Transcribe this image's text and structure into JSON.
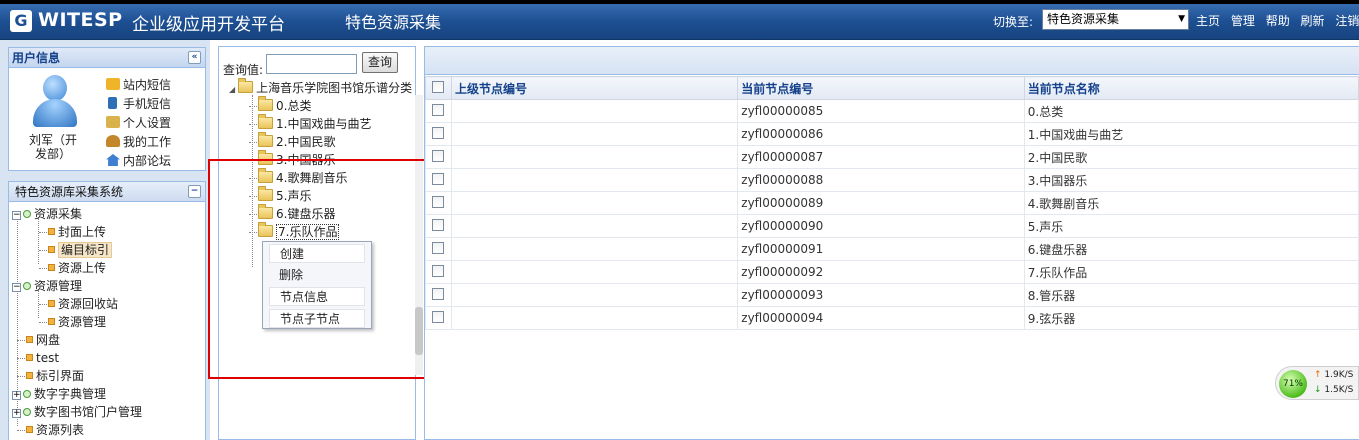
{
  "header": {
    "logo_mark": "G",
    "logo_text": "WITESP",
    "logo_sub": "企业级应用开发平台",
    "page_title": "特色资源采集",
    "switch_label": "切换至:",
    "switch_value": "特色资源采集",
    "links": [
      "主页",
      "管理",
      "帮助",
      "刷新",
      "注销"
    ]
  },
  "user_panel": {
    "title": "用户信息",
    "collapse_glyph": "«",
    "user_name": "刘军（开发部）",
    "links": [
      {
        "label": "站内短信",
        "icon": "mail-icon",
        "color": "#f0b429"
      },
      {
        "label": "手机短信",
        "icon": "phone-icon",
        "color": "#2f6fb8"
      },
      {
        "label": "个人设置",
        "icon": "pencil-icon",
        "color": "#d9b24c"
      },
      {
        "label": "我的工作",
        "icon": "worker-icon",
        "color": "#c4862b"
      },
      {
        "label": "内部论坛",
        "icon": "home-icon",
        "color": "#3e7fcf"
      }
    ]
  },
  "nav_panel": {
    "title": "特色资源库采集系统",
    "collapse_glyph": "−",
    "items": [
      {
        "label": "资源采集"
      },
      {
        "label": "封面上传"
      },
      {
        "label": "编目标引"
      },
      {
        "label": "资源上传"
      },
      {
        "label": "资源管理"
      },
      {
        "label": "资源回收站"
      },
      {
        "label": "资源管理"
      },
      {
        "label": "网盘"
      },
      {
        "label": "test"
      },
      {
        "label": "标引界面"
      },
      {
        "label": "数字字典管理"
      },
      {
        "label": "数字图书馆门户管理"
      },
      {
        "label": "资源列表"
      }
    ]
  },
  "tree": {
    "query_label": "查询值:",
    "query_value": "",
    "query_button": "查询",
    "root": "上海音乐学院图书馆乐谱分类",
    "nodes": [
      "0.总类",
      "1.中国戏曲与曲艺",
      "2.中国民歌",
      "3.中国器乐",
      "4.歌舞剧音乐",
      "5.声乐",
      "6.键盘乐器",
      "7.乐队作品"
    ]
  },
  "context_menu": {
    "items": [
      "创建",
      "删除",
      "节点信息",
      "节点子节点"
    ]
  },
  "grid": {
    "columns": [
      "上级节点编号",
      "当前节点编号",
      "当前节点名称"
    ],
    "rows": [
      {
        "parent": "",
        "code": "zyfl00000085",
        "name": "0.总类"
      },
      {
        "parent": "",
        "code": "zyfl00000086",
        "name": "1.中国戏曲与曲艺"
      },
      {
        "parent": "",
        "code": "zyfl00000087",
        "name": "2.中国民歌"
      },
      {
        "parent": "",
        "code": "zyfl00000088",
        "name": "3.中国器乐"
      },
      {
        "parent": "",
        "code": "zyfl00000089",
        "name": "4.歌舞剧音乐"
      },
      {
        "parent": "",
        "code": "zyfl00000090",
        "name": "5.声乐"
      },
      {
        "parent": "",
        "code": "zyfl00000091",
        "name": "6.键盘乐器"
      },
      {
        "parent": "",
        "code": "zyfl00000092",
        "name": "7.乐队作品"
      },
      {
        "parent": "",
        "code": "zyfl00000093",
        "name": "8.管乐器"
      },
      {
        "parent": "",
        "code": "zyfl00000094",
        "name": "9.弦乐器"
      }
    ]
  },
  "net_widget": {
    "percent": "71%",
    "up_arrow": "↑",
    "down_arrow": "↓",
    "up": "1.9K/S",
    "down": "1.5K/S"
  }
}
